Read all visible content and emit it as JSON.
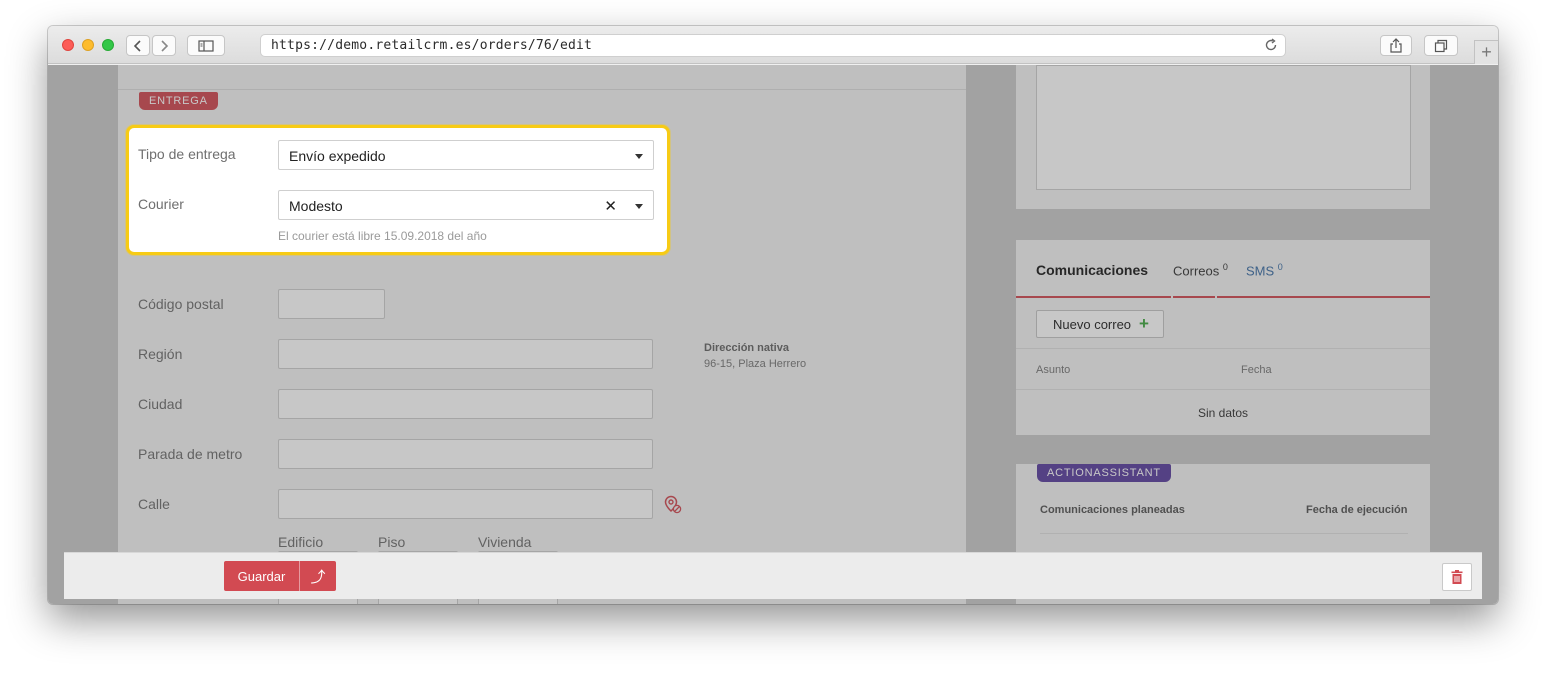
{
  "browser": {
    "url": "https://demo.retailcrm.es/orders/76/edit",
    "new_tab_label": "+"
  },
  "delivery": {
    "section_tag": "ENTREGA",
    "type_label": "Tipo de entrega",
    "type_value": "Envío expedido",
    "courier_label": "Courier",
    "courier_value": "Modesto",
    "clear_glyph": "✕",
    "courier_hint": "El courier está libre 15.09.2018 del año",
    "postal_label": "Código postal",
    "region_label": "Región",
    "city_label": "Ciudad",
    "metro_label": "Parada de metro",
    "street_label": "Calle",
    "building_label": "Edificio",
    "floor_label": "Piso",
    "apartment_label": "Vivienda",
    "native_address_title": "Dirección nativa",
    "native_address_value": "96-15, Plaza Herrero"
  },
  "communications": {
    "tab_main": "Comunicaciones",
    "tab_emails": "Correos",
    "tab_emails_count": "0",
    "tab_sms": "SMS",
    "tab_sms_count": "0",
    "new_email_button": "Nuevo correo",
    "col_subject": "Asunto",
    "col_date": "Fecha",
    "empty_text": "Sin datos"
  },
  "action_assistant": {
    "tag": "ACTIONASSISTANT",
    "col_planned": "Comunicaciones planeadas",
    "col_exec_date": "Fecha de ejecución"
  },
  "footer": {
    "save_label": "Guardar"
  },
  "colors": {
    "accent_red": "#d24a52",
    "highlight_yellow": "#f7cb15",
    "assistant_purple": "#5b3f9f",
    "add_green": "#3fa83f"
  }
}
